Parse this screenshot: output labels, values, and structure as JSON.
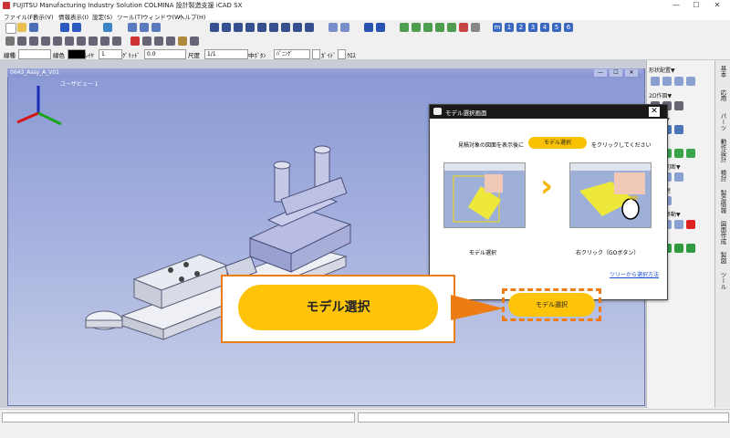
{
  "window": {
    "title": "FUJITSU Manufacturing Industry Solution COLMINA 設計製造支援 iCAD SX",
    "minimize": "—",
    "maximize": "☐",
    "close": "✕"
  },
  "menu": [
    "ファイル(F)",
    "表示(V)",
    "情報表示(I)",
    "設定(S)",
    "ツール(T)",
    "ウィンドウ(W)",
    "ヘルプ(H)"
  ],
  "propbar": {
    "line_type_label": "線種",
    "line_color_label": "線色",
    "layer_label": "ﾚｲﾔ",
    "layer_value": "1",
    "grid_label": "ｸﾞﾘｯﾄﾞ",
    "grid_value": "0.0",
    "scale_label": "尺度",
    "scale_value": "1/1",
    "center_label": "中ﾎﾞﾀﾝ",
    "center_value": "ﾊﾟﾆﾝｸﾞ",
    "check1_label": "ｶﾞｲﾄﾞ",
    "check2_label": "ｸﾛｽ"
  },
  "toolbar_letters": [
    "m",
    "1",
    "2",
    "3",
    "4",
    "5",
    "6"
  ],
  "viewport": {
    "window_title": "0643_Assy_A_V01",
    "view_name": "ユーザビュー 1",
    "btn_min": "—",
    "btn_max": "☐",
    "btn_close": "✕"
  },
  "right_panel": {
    "sections": [
      "形状配置▼",
      "2D作図▼",
      "立体化▼",
      "属性▼",
      "整形・切断▼",
      "形状変更",
      "編集・移動▼",
      "検索▼"
    ]
  },
  "vertical_tabs": [
    "基本",
    "応用",
    "パーツ",
    "動作設計",
    "検討",
    "製造情報",
    "図面作成",
    "製図",
    "ツール"
  ],
  "dialog": {
    "title": "モデル選択画面",
    "close": "✕",
    "instruction_before": "見積対象の図面を表示後に",
    "instruction_pill": "モデル選択",
    "instruction_after": "をクリックしてください",
    "left_caption": "モデル選択",
    "right_caption": "右クリック（GOボタン）",
    "right_badge": "GO",
    "link": "ツリーから選択方法",
    "button": "モデル選択"
  },
  "callout": {
    "big_button": "モデル選択"
  },
  "colors": {
    "accent_yellow": "#fdc40a",
    "callout_orange": "#ee7c14",
    "viewport_blue": "#8a98d4"
  }
}
